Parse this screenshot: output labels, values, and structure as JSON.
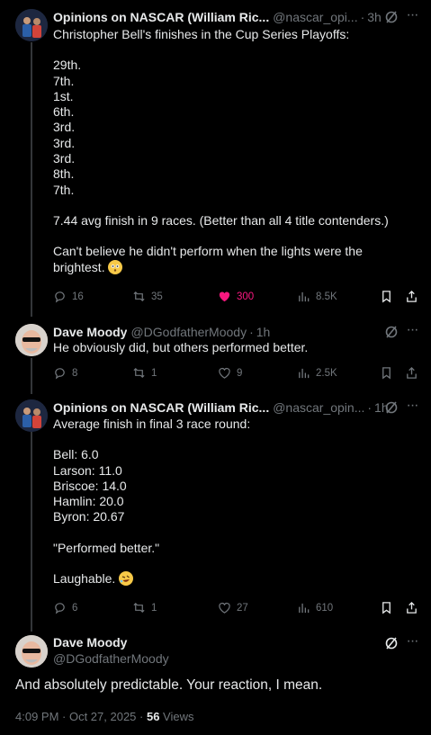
{
  "tweets": [
    {
      "name": "Opinions on NASCAR (William Ric...",
      "handle": "@nascar_opi...",
      "sep": "·",
      "time": "3h",
      "text_lines": [
        "Christopher Bell's finishes in the Cup Series Playoffs:",
        "",
        "29th.",
        "7th.",
        "1st.",
        "6th.",
        "3rd.",
        "3rd.",
        "3rd.",
        "8th.",
        "7th.",
        "",
        "7.44 avg finish in 9 races. (Better than all 4 title contenders.)",
        "",
        "Can't believe he didn't perform when the lights were the",
        "brightest."
      ],
      "emoji": "flushed-face-emoji",
      "replies": "16",
      "reposts": "35",
      "likes": "300",
      "views": "8.5K"
    },
    {
      "name": "Dave Moody",
      "handle": "@DGodfatherMoody",
      "sep": "·",
      "time": "1h",
      "text": "He obviously did, but others performed better.",
      "replies": "8",
      "reposts": "1",
      "likes": "9",
      "views": "2.5K"
    },
    {
      "name": "Opinions on NASCAR (William Ric...",
      "handle": "@nascar_opin...",
      "sep": "·",
      "time": "1h",
      "text_lines": [
        "Average finish in final 3 race round:",
        "",
        "Bell: 6.0",
        "Larson: 11.0",
        "Briscoe: 14.0",
        "Hamlin: 20.0",
        "Byron: 20.67",
        "",
        "\"Performed better.\"",
        "",
        "Laughable."
      ],
      "emoji": "rofl-emoji",
      "replies": "6",
      "reposts": "1",
      "likes": "27",
      "views": "610"
    }
  ],
  "focus": {
    "name": "Dave Moody",
    "handle": "@DGodfatherMoody",
    "text": "And absolutely predictable. Your reaction, I mean.",
    "timestamp": "4:09 PM · Oct 27, 2025 · ",
    "views_count": "56",
    "views_label": " Views"
  },
  "colors": {
    "like_active": "#f91880",
    "muted": "#71767b",
    "text": "#e7e9ea"
  }
}
